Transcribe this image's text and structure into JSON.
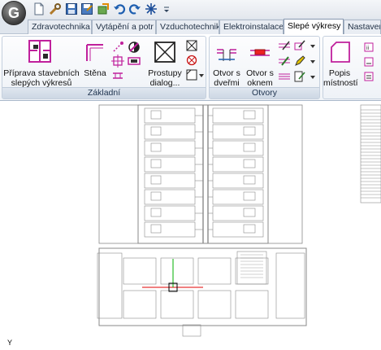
{
  "app": {
    "logo_letter": "G"
  },
  "quick_access": {
    "icons": [
      "new-file-icon",
      "settings-wrench-icon",
      "save-icon",
      "save-as-icon",
      "export-icon",
      "undo-icon",
      "redo-icon",
      "snowflake-icon",
      "dropdown-arrow-icon"
    ]
  },
  "tabs": [
    {
      "label": "Zdravotechnika"
    },
    {
      "label": "Vytápění a potr"
    },
    {
      "label": "Vzduchotechnik"
    },
    {
      "label": "Elektroinstalace"
    },
    {
      "label": "Slepé výkresy",
      "active": true
    },
    {
      "label": "Nastaven"
    }
  ],
  "panels": {
    "zakladni": {
      "title": "Základní",
      "buttons": {
        "priprava": {
          "line1": "Příprava stavebních",
          "line2": "slepých výkresů"
        },
        "stena": {
          "label": "Stěna"
        },
        "prostupy": {
          "line1": "Prostupy",
          "line2": "dialog..."
        }
      }
    },
    "otvory": {
      "title": "Otvory",
      "buttons": {
        "dvere": {
          "line1": "Otvor s",
          "line2": "dveřmi"
        },
        "okno": {
          "line1": "Otvor s",
          "line2": "oknem"
        }
      }
    },
    "popis": {
      "buttons": {
        "popis": {
          "line1": "Popis",
          "line2": "místností"
        }
      }
    }
  },
  "colors": {
    "accent_magenta": "#c0209c",
    "crosshair_red": "#e00000",
    "crosshair_green": "#00b000",
    "ribbon_blue": "#203550"
  },
  "status": {
    "axis_label": "Y"
  }
}
